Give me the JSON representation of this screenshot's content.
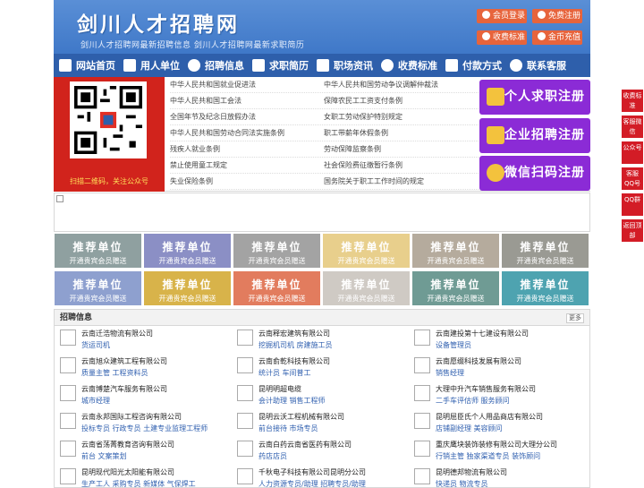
{
  "header": {
    "logo": "剑川人才招聘网",
    "slogan": "剑川人才招聘网最新招聘信息  剑川人才招聘网最新求职简历",
    "buttons": [
      "会员登录",
      "免费注册",
      "收费标准",
      "金币充值"
    ]
  },
  "nav": {
    "items": [
      "网站首页",
      "用人单位",
      "招聘信息",
      "求职简历",
      "职场资讯",
      "收费标准",
      "付款方式",
      "联系客服"
    ]
  },
  "qr": {
    "caption": "扫描二维码，关注公众号"
  },
  "law_links": [
    [
      "中华人民共和国就业促进法",
      "中华人民共和国劳动争议调解仲裁法"
    ],
    [
      "中华人民共和国工会法",
      "保障农民工工资支付条例"
    ],
    [
      "全国年节及纪念日放假办法",
      "女职工劳动保护特别规定"
    ],
    [
      "中华人民共和国劳动合同法实施条例",
      "职工带薪年休假条例"
    ],
    [
      "残疾人就业条例",
      "劳动保障监察条例"
    ],
    [
      "禁止使用童工规定",
      "社会保险费征缴暂行条例"
    ],
    [
      "失业保险条例",
      "国务院关于职工工作时间的规定"
    ]
  ],
  "register": {
    "personal": "个人求职注册",
    "company": "企业招聘注册",
    "wechat": "微信扫码注册"
  },
  "recommend": {
    "title": "推荐单位",
    "subtitle": "开通贵宾会员赠送",
    "colors": [
      "#8fa0a0",
      "#8b8fc5",
      "#a3a3a3",
      "#e8cf8c",
      "#b5ab9d",
      "#9a9a93",
      "#8ea0cf",
      "#d8b34a",
      "#e27c5e",
      "#cfcac4",
      "#6f9b94",
      "#4ea3b0"
    ]
  },
  "jobs": {
    "title": "招聘信息",
    "more": "更多",
    "items": [
      {
        "company": "云南迁浩物流有限公司",
        "positions": "货运司机"
      },
      {
        "company": "云南释宏建筑有限公司",
        "positions": "挖掘机司机 房建施工员"
      },
      {
        "company": "云南建投第十七建设有限公司",
        "positions": "设备管理员"
      },
      {
        "company": "云南旭众建筑工程有限公司",
        "positions": "质量主管 工程资料员"
      },
      {
        "company": "云南俞乾科技有限公司",
        "positions": "统计员 车间普工"
      },
      {
        "company": "云南愿缀科技发展有限公司",
        "positions": "销售经理"
      },
      {
        "company": "云南博楚汽车服务有限公司",
        "positions": "城市经理"
      },
      {
        "company": "昆明明超电缆",
        "positions": "会计助理 销售工程师"
      },
      {
        "company": "大理中升汽车销售服务有限公司",
        "positions": "二手车评估师 服务顾问"
      },
      {
        "company": "云南永邦国际工程咨询有限公司",
        "positions": "投标专员 行政专员 土建专业监理工程师"
      },
      {
        "company": "昆明云沃工程机械有限公司",
        "positions": "前台接待 市场专员"
      },
      {
        "company": "昆明屈臣氏个人用品商店有限公司",
        "positions": "店铺副经理 美容顾问"
      },
      {
        "company": "云南省荡菁教育咨询有限公司",
        "positions": "前台 文案策划"
      },
      {
        "company": "云南白药云南省医药有限公司",
        "positions": "药店店员"
      },
      {
        "company": "重庆鹰块装饰装修有限公司大理分公司",
        "positions": "行销主管 独家渠道专员 装饰顾问"
      },
      {
        "company": "昆明现代阳光太阳能有限公司",
        "positions": "生产工人 采购专员 新媒体 气保焊工"
      },
      {
        "company": "千秋电子科技有限公司昆明分公司",
        "positions": "人力资源专员/助理 招聘专员/助理"
      },
      {
        "company": "昆明德邦物流有限公司",
        "positions": "快递员 物流专员"
      }
    ]
  },
  "side": [
    "收费标准",
    "客服微信",
    "公众号",
    "客服QQ号",
    "QQ群",
    "返回顶部"
  ],
  "colors": {
    "brand": "#2e5fab",
    "header": "#4a84cf",
    "accent": "#e7643c",
    "register": "#8b2bd6",
    "side": "#d31c26"
  }
}
